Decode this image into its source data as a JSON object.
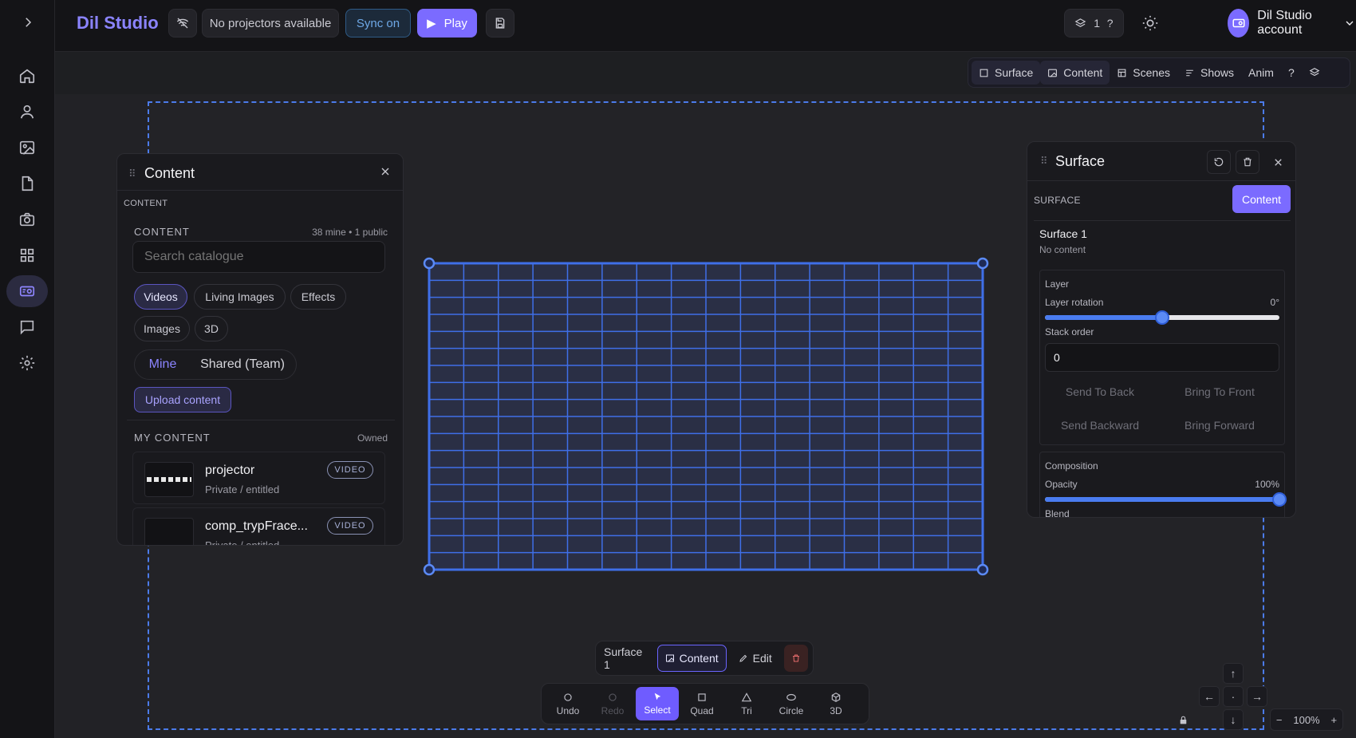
{
  "header": {
    "brand": "Dil Studio",
    "projectors": "No projectors available",
    "sync": "Sync on",
    "play": "Play",
    "layers_count": "1",
    "help": "?",
    "account": "Dil Studio account"
  },
  "modetabs": {
    "surface": "Surface",
    "content": "Content",
    "scenes": "Scenes",
    "shows": "Shows",
    "anim": "Anim",
    "help": "?"
  },
  "content_panel": {
    "title": "Content",
    "section": "CONTENT",
    "subtitle": "CONTENT",
    "counts": "38 mine • 1 public",
    "search_placeholder": "Search catalogue",
    "filters": [
      "Videos",
      "Living Images",
      "Effects",
      "Images",
      "3D"
    ],
    "active_filter": "Videos",
    "scope_mine": "Mine",
    "scope_shared": "Shared (Team)",
    "upload": "Upload content",
    "my_content": "MY CONTENT",
    "owned": "Owned",
    "items": [
      {
        "name": "projector",
        "sub": "Private / entitled",
        "badge": "VIDEO"
      },
      {
        "name": "comp_trypFrace...",
        "sub": "Private / entitled",
        "badge": "VIDEO"
      }
    ]
  },
  "surface_panel": {
    "title": "Surface",
    "section": "SURFACE",
    "content_btn": "Content",
    "surface_name": "Surface 1",
    "surface_status": "No content",
    "layer": "Layer",
    "rotation_label": "Layer rotation",
    "rotation_value": "0°",
    "rotation_fraction": 0.5,
    "stack_label": "Stack order",
    "stack_value": "0",
    "send_back": "Send To Back",
    "bring_front": "Bring To Front",
    "send_backward": "Send Backward",
    "bring_forward": "Bring Forward",
    "composition": "Composition",
    "opacity_label": "Opacity",
    "opacity_value": "100%",
    "opacity_fraction": 1.0,
    "blend_label": "Blend"
  },
  "surface_bar": {
    "name": "Surface 1",
    "content": "Content",
    "edit": "Edit"
  },
  "tools": [
    {
      "label": "Undo",
      "state": "normal"
    },
    {
      "label": "Redo",
      "state": "dim"
    },
    {
      "label": "Select",
      "state": "on"
    },
    {
      "label": "Quad",
      "state": "normal"
    },
    {
      "label": "Tri",
      "state": "normal"
    },
    {
      "label": "Circle",
      "state": "normal"
    },
    {
      "label": "3D",
      "state": "normal"
    }
  ],
  "zoom": "100%",
  "colors": {
    "accent": "#7b6bff",
    "grid": "#3f6fe8",
    "bg": "#1e1f22"
  }
}
